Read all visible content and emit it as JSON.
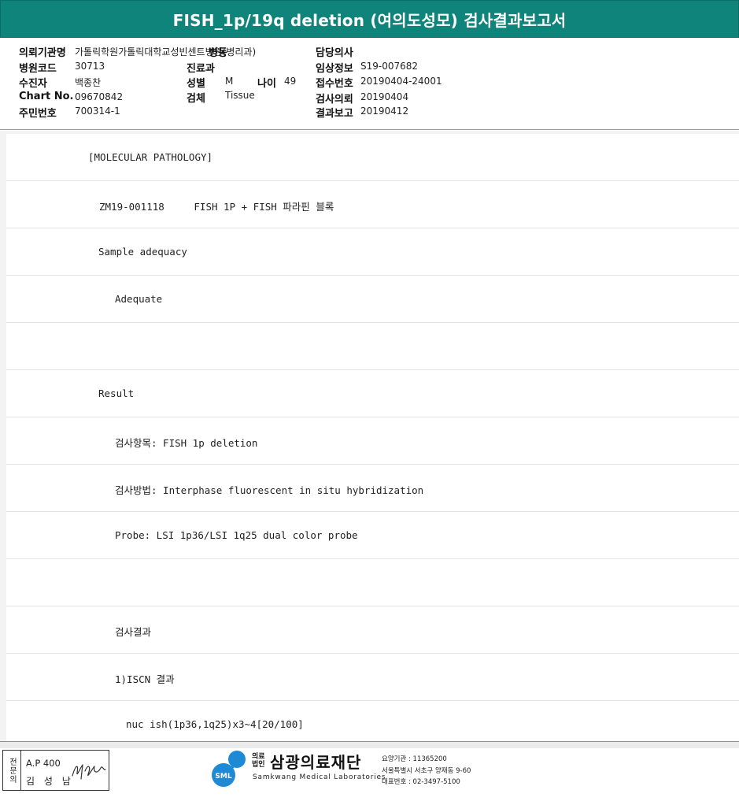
{
  "header": {
    "title": "FISH_1p/19q deletion (여의도성모) 검사결과보고서"
  },
  "info": {
    "institution_label": "의뢰기관명",
    "institution_value": "가톨릭학원가톨릭대학교성빈센트병원(병리과)",
    "ward_label": "병동",
    "hospital_code_label": "병원코드",
    "hospital_code_value": "30713",
    "dept_label": "진료과",
    "patient_label": "수진자",
    "patient_value": "백종찬",
    "sex_label": "성별",
    "sex_value": "M",
    "age_label": "나이",
    "age_value": "49",
    "chart_label": "Chart No.",
    "chart_value": "09670842",
    "specimen_label": "검체",
    "specimen_value": "Tissue",
    "rrn_label": "주민번호",
    "rrn_value": "700314-1",
    "doctor_label": "담당의사",
    "clinical_label": "임상정보",
    "clinical_value": "S19-007682",
    "receipt_label": "접수번호",
    "receipt_value": "20190404-24001",
    "request_label": "검사의뢰",
    "request_value": "20190404",
    "result_date_label": "결과보고",
    "result_date_value": "20190412"
  },
  "report": {
    "lines": [
      "[MOLECULAR PATHOLOGY]",
      "ZM19-001118     FISH 1P + FISH 파라핀 블록",
      "Sample adequacy",
      "Adequate",
      "",
      "Result",
      "검사항목: FISH 1p deletion",
      "검사방법: Interphase fluorescent in situ hybridization",
      "Probe: LSI 1p36/LSI 1q25 dual color probe",
      "",
      "검사결과",
      "1)ISCN 결과",
      "nuc ish(1p36,1q25)x3~4[20/100]"
    ]
  },
  "footer": {
    "sign_tag": "전문의",
    "sign_code": "A.P 400",
    "sign_name": "김 성 남",
    "logo_badge": "SML",
    "logo_kind": "의료법인",
    "logo_name": "삼광의료재단",
    "logo_eng": "Samkwang Medical Laboratories",
    "contact_1": "요양기관 : 11365200",
    "contact_2": "서울특별시 서초구 양재동 9-60",
    "contact_3": "대표번호 : 02-3497-5100"
  },
  "colors": {
    "header_bg": "#0f847a",
    "logo_blue": "#1e8ad6"
  }
}
